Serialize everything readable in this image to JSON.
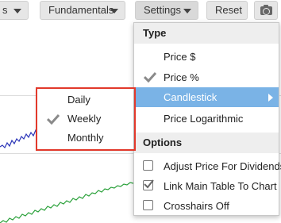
{
  "toolbar": {
    "left_button_label": "s",
    "fundamentals_label": "Fundamentals",
    "settings_label": "Settings",
    "reset_label": "Reset"
  },
  "settings_menu": {
    "type_header": "Type",
    "type_items": [
      {
        "label": "Price $",
        "checked": false
      },
      {
        "label": "Price %",
        "checked": true
      },
      {
        "label": "Candlestick",
        "checked": false,
        "active": true,
        "has_submenu": true
      },
      {
        "label": "Price Logarithmic",
        "checked": false
      }
    ],
    "options_header": "Options",
    "option_items": [
      {
        "label": "Adjust Price For Dividends",
        "checked": false
      },
      {
        "label": "Link Main Table To Chart",
        "checked": true
      },
      {
        "label": "Crosshairs Off",
        "checked": false
      }
    ]
  },
  "period_menu": {
    "items": [
      {
        "label": "Daily",
        "checked": false
      },
      {
        "label": "Weekly",
        "checked": true
      },
      {
        "label": "Monthly",
        "checked": false
      }
    ]
  },
  "colors": {
    "active_item": "#7ab3e6",
    "highlight_border": "#e2392b",
    "blue_series": "#2b35b8",
    "green_series": "#2aa13a"
  },
  "icons": {
    "camera": "camera-icon",
    "checkmark": "checkmark-icon"
  }
}
